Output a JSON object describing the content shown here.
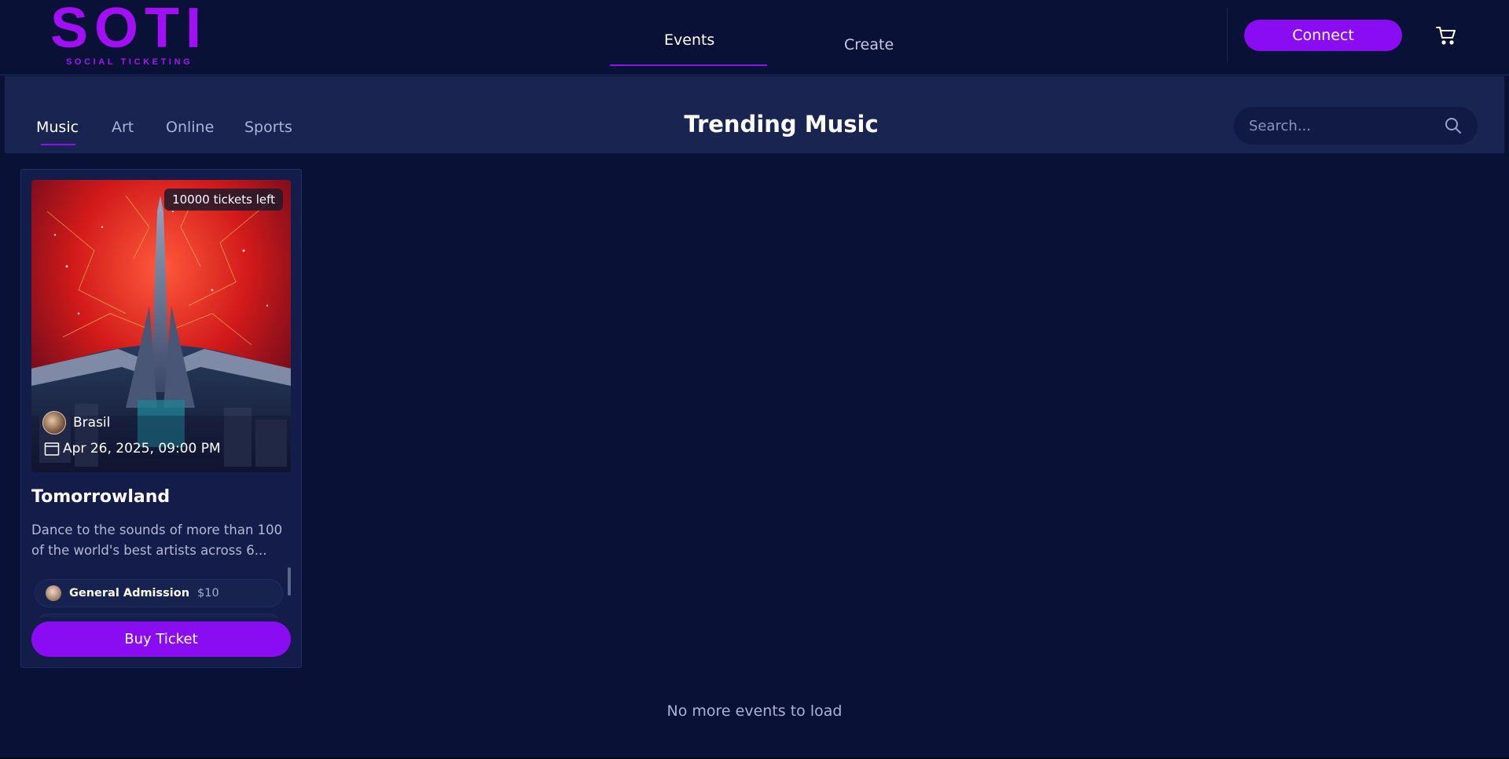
{
  "brand": {
    "logo_text": "SOTI",
    "logo_subtitle": "SOCIAL TICKETING",
    "accent_color": "#8a0cf3"
  },
  "nav": {
    "tabs": [
      {
        "label": "Events",
        "active": true
      },
      {
        "label": "Create",
        "active": false
      }
    ],
    "connect_label": "Connect",
    "cart_icon": "cart-icon"
  },
  "categories": {
    "tabs": [
      {
        "label": "Music",
        "active": true
      },
      {
        "label": "Art",
        "active": false
      },
      {
        "label": "Online",
        "active": false
      },
      {
        "label": "Sports",
        "active": false
      }
    ],
    "title": "Trending Music",
    "search": {
      "placeholder": "Search...",
      "value": "",
      "icon": "search-icon"
    }
  },
  "events": [
    {
      "tickets_left": "10000 tickets left",
      "location": "Brasil",
      "date": "Apr 26, 2025, 09:00 PM",
      "title": "Tomorrowland",
      "description": "Dance to the sounds of more than 100 of the world's best artists across 6...",
      "ticket_types": [
        {
          "name": "General Admission",
          "price": "$10"
        }
      ],
      "buy_label": "Buy Ticket"
    }
  ],
  "footer": {
    "message": "No more events to load"
  }
}
